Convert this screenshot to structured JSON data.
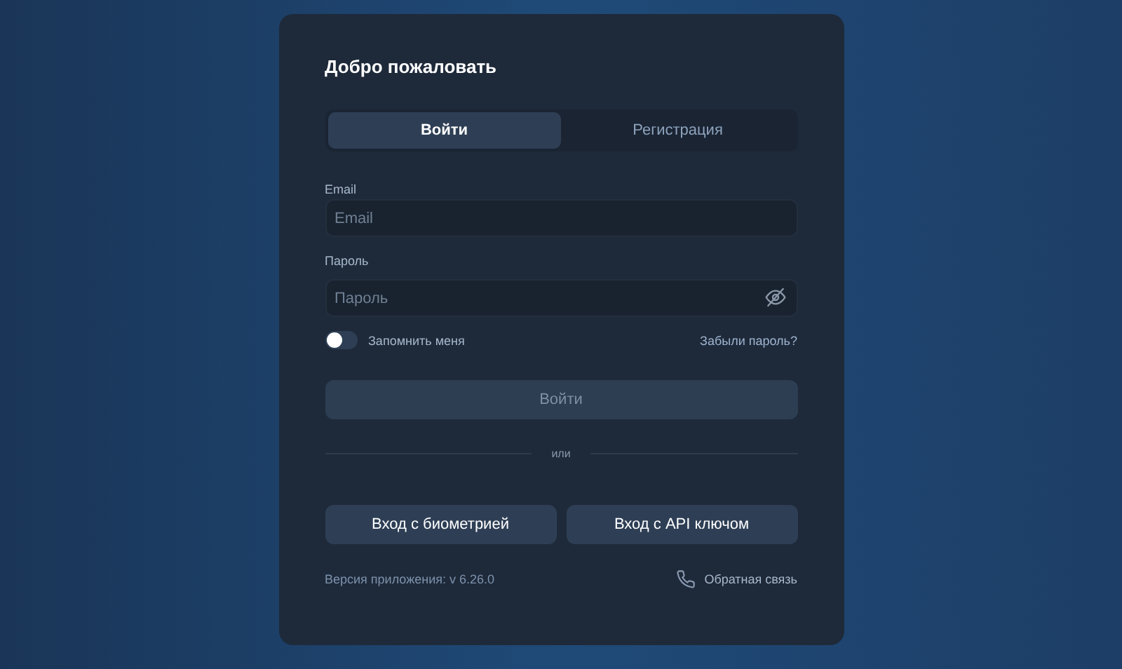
{
  "title": "Добро пожаловать",
  "tabs": [
    {
      "label": "Войти",
      "selected": true
    },
    {
      "label": "Регистрация",
      "selected": false
    }
  ],
  "email": {
    "label": "Email",
    "placeholder": "Email"
  },
  "password": {
    "label": "Пароль",
    "placeholder": "Пароль"
  },
  "remember": {
    "label": "Запомнить меня",
    "on": false
  },
  "forgot_link": "Забыли пароль?",
  "submit": {
    "label": "Войти",
    "disabled": true
  },
  "divider_text": "или",
  "alt_buttons": [
    "Вход с биометрией",
    "Вход с API ключом"
  ],
  "version": "Версия приложения: v 6.26.0",
  "feedback_link": "Обратная связь"
}
